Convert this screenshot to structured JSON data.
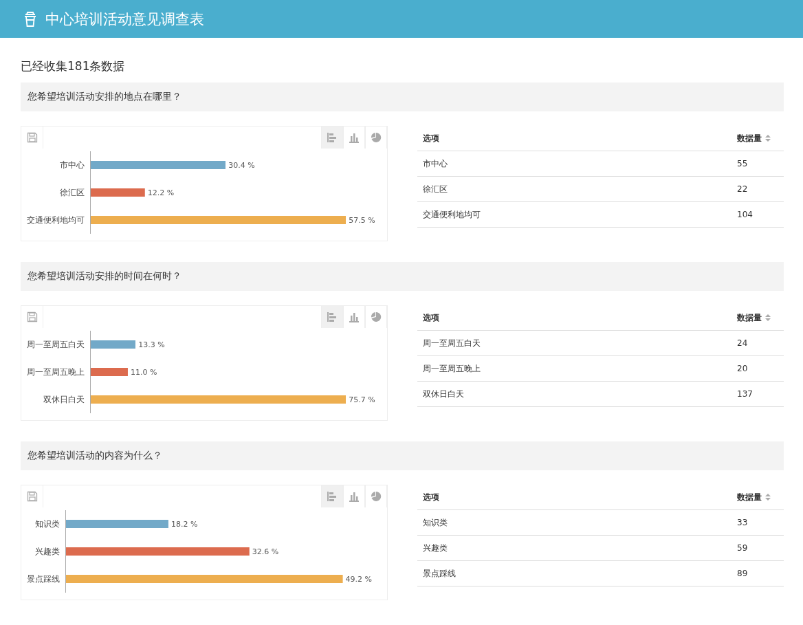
{
  "header": {
    "title": "中心培训活动意见调查表"
  },
  "summary": "已经收集181条数据",
  "questions": [
    {
      "title": "您希望培训活动安排的地点在哪里？",
      "view_buttons": [
        {
          "kind": "hbar",
          "selected": true
        },
        {
          "kind": "vbar",
          "selected": false
        },
        {
          "kind": "pie",
          "selected": false
        }
      ],
      "chart_data": {
        "type": "bar",
        "orientation": "horizontal",
        "categories": [
          "市中心",
          "徐汇区",
          "交通便利地均可"
        ],
        "values": [
          30.4,
          12.2,
          57.5
        ],
        "value_labels": [
          "30.4 %",
          "12.2 %",
          "57.5 %"
        ]
      },
      "table": {
        "columns": [
          "选项",
          "数据量"
        ],
        "rows": [
          [
            "市中心",
            "55"
          ],
          [
            "徐汇区",
            "22"
          ],
          [
            "交通便利地均可",
            "104"
          ]
        ]
      }
    },
    {
      "title": "您希望培训活动安排的时间在何时？",
      "view_buttons": [
        {
          "kind": "hbar",
          "selected": true
        },
        {
          "kind": "vbar",
          "selected": false
        },
        {
          "kind": "pie",
          "selected": false
        }
      ],
      "chart_data": {
        "type": "bar",
        "orientation": "horizontal",
        "categories": [
          "周一至周五白天",
          "周一至周五晚上",
          "双休日白天"
        ],
        "values": [
          13.3,
          11.0,
          75.7
        ],
        "value_labels": [
          "13.3 %",
          "11.0 %",
          "75.7 %"
        ]
      },
      "table": {
        "columns": [
          "选项",
          "数据量"
        ],
        "rows": [
          [
            "周一至周五白天",
            "24"
          ],
          [
            "周一至周五晚上",
            "20"
          ],
          [
            "双休日白天",
            "137"
          ]
        ]
      }
    },
    {
      "title": "您希望培训活动的内容为什么？",
      "view_buttons": [
        {
          "kind": "hbar",
          "selected": true
        },
        {
          "kind": "vbar",
          "selected": false
        },
        {
          "kind": "pie",
          "selected": false
        }
      ],
      "chart_data": {
        "type": "bar",
        "orientation": "horizontal",
        "categories": [
          "知识类",
          "兴趣类",
          "景点踩线"
        ],
        "values": [
          18.2,
          32.6,
          49.2
        ],
        "value_labels": [
          "18.2 %",
          "32.6 %",
          "49.2 %"
        ]
      },
      "table": {
        "columns": [
          "选项",
          "数据量"
        ],
        "rows": [
          [
            "知识类",
            "33"
          ],
          [
            "兴趣类",
            "59"
          ],
          [
            "景点踩线",
            "89"
          ]
        ]
      }
    }
  ]
}
